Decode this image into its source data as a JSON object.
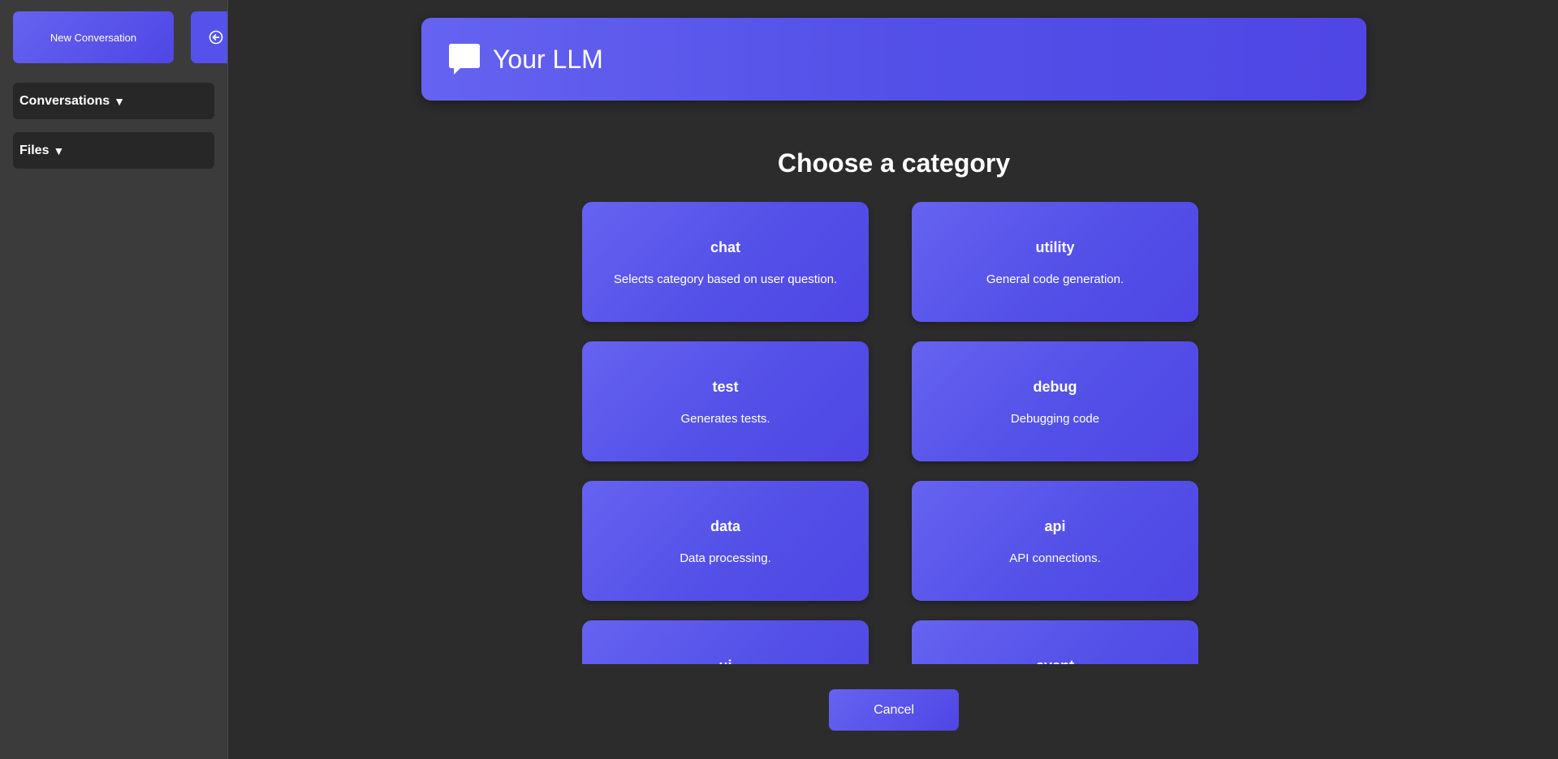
{
  "sidebar": {
    "new_conversation_label": "New Conversation",
    "collapse_icon": "arrow-left-circle-icon",
    "sections": [
      {
        "label": "Conversations",
        "icon": "triangle-down-icon"
      },
      {
        "label": "Files",
        "icon": "triangle-down-icon"
      }
    ],
    "triangle": "▼"
  },
  "header": {
    "title": "Your LLM",
    "logo_icon": "chat-bubble-icon"
  },
  "main": {
    "heading": "Choose a category",
    "categories": [
      {
        "name": "chat",
        "description": "Selects category based on user question."
      },
      {
        "name": "utility",
        "description": "General code generation."
      },
      {
        "name": "test",
        "description": "Generates tests."
      },
      {
        "name": "debug",
        "description": "Debugging code"
      },
      {
        "name": "data",
        "description": "Data processing."
      },
      {
        "name": "api",
        "description": "API connections."
      },
      {
        "name": "ui",
        "description": ""
      },
      {
        "name": "event",
        "description": ""
      }
    ],
    "cancel_label": "Cancel"
  },
  "colors": {
    "accent_start": "#6563f0",
    "accent_end": "#4f46e5",
    "background": "#2c2c2c",
    "sidebar": "#3b3b3b"
  }
}
